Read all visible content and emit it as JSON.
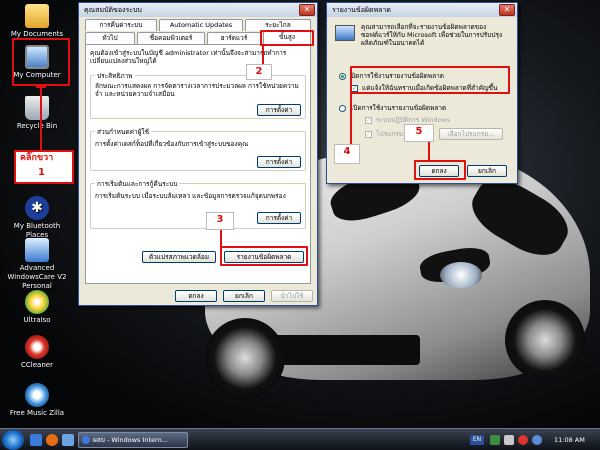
{
  "desktop": {
    "icons": [
      {
        "label": "My Documents",
        "icon": "folder-icon"
      },
      {
        "label": "My Computer",
        "icon": "computer-icon"
      },
      {
        "label": "Recycle Bin",
        "icon": "recycle-bin-icon"
      },
      {
        "label": "In",
        "icon": "shortcut-icon"
      },
      {
        "label": "My Bluetooth Places",
        "icon": "bluetooth-icon"
      },
      {
        "label": "Advanced WindowsCare V2 Personal",
        "icon": "windowscare-icon"
      },
      {
        "label": "UltraIso",
        "icon": "ultraiso-icon"
      },
      {
        "label": "CCleaner",
        "icon": "ccleaner-icon"
      },
      {
        "label": "Free Music Zilla",
        "icon": "music-icon"
      }
    ]
  },
  "sysprop": {
    "title": "คุณสมบัติของระบบ",
    "tabs_top": [
      "การคืนค่าระบบ",
      "Automatic Updates",
      "ระยะไกล"
    ],
    "tabs_bottom": [
      "ทั่วไป",
      "ชื่อคอมพิวเตอร์",
      "ฮาร์ดแวร์",
      "ขั้นสูง"
    ],
    "intro": "คุณต้องเข้าสู่ระบบในบัญชี administrator เท่านั้นจึงจะสามารถทำการเปลี่ยนแปลงส่วนใหญ่ได้",
    "groups": [
      {
        "title": "ประสิทธิภาพ",
        "text": "ลักษณะการแสดงผล การจัดตารางเวลาการประมวลผล การใช้หน่วยความจำ และหน่วยความจำเสมือน",
        "button": "การตั้งค่า"
      },
      {
        "title": "ส่วนกำหนดค่าผู้ใช้",
        "text": "การตั้งค่าเดสก์ท็อปที่เกี่ยวข้องกับการเข้าสู่ระบบของคุณ",
        "button": "การตั้งค่า"
      },
      {
        "title": "การเริ่มต้นและการกู้คืนระบบ",
        "text": "การเริ่มต้นระบบ เมื่อระบบล้มเหลว และข้อมูลการตรวจแก้จุดบกพร่อง",
        "button": "การตั้งค่า"
      }
    ],
    "env_button": "ตัวแปรสภาพแวดล้อม",
    "error_button": "รายงานข้อผิดพลาด",
    "ok": "ตกลง",
    "cancel": "ยกเลิก",
    "apply": "นำไปใช้"
  },
  "errreport": {
    "title": "รายงานข้อผิดพลาด",
    "text": "คุณสามารถเลือกที่จะรายงานข้อผิดพลาดของซอฟต์แวร์ให้กับ Microsoft เพื่อช่วยในการปรับปรุงผลิตภัณฑ์ในอนาคตได้",
    "opt_disable": "ปิดการใช้งานรายงานข้อผิดพลาด",
    "opt_notify": "แต่แจ้งให้ฉันทราบเมื่อเกิดข้อผิดพลาดที่สำคัญขึ้น",
    "opt_enable": "เปิดการใช้งานรายงานข้อผิดพลาด",
    "opt_windows": "ระบบปฏิบัติการ Windows",
    "opt_programs": "โปรแกรม",
    "choose_button": "เลือกโปรแกรม...",
    "ok": "ตกลง",
    "cancel": "ยกเลิก"
  },
  "annotations": {
    "click_right": "คลิ๊กขวา",
    "steps": [
      "1",
      "2",
      "3",
      "4",
      "5"
    ]
  },
  "taskbar": {
    "task": "ผลบ - Windows Intern...",
    "lang": "EN",
    "time": "11:08 AM"
  },
  "colors": {
    "annotation": "#e01010",
    "xp_blue": "#2a4e9c",
    "dialog": "#ece9d8"
  }
}
